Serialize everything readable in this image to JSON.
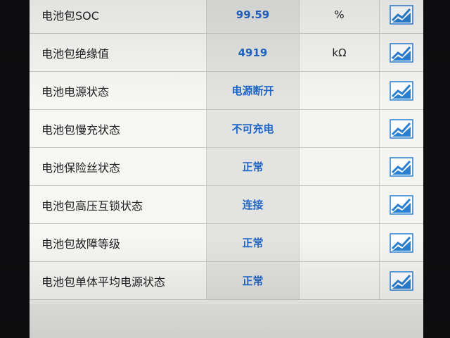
{
  "rows": [
    {
      "label": "电池包SOC",
      "value": "99.59",
      "unit": "%",
      "icon": "trend-chart-icon"
    },
    {
      "label": "电池包绝缘值",
      "value": "4919",
      "unit": "kΩ",
      "icon": "trend-chart-icon"
    },
    {
      "label": "电池电源状态",
      "value": "电源断开",
      "unit": "",
      "icon": "trend-chart-icon"
    },
    {
      "label": "电池包慢充状态",
      "value": "不可充电",
      "unit": "",
      "icon": "trend-chart-icon"
    },
    {
      "label": "电池保险丝状态",
      "value": "正常",
      "unit": "",
      "icon": "trend-chart-icon"
    },
    {
      "label": "电池包高压互锁状态",
      "value": "连接",
      "unit": "",
      "icon": "trend-chart-icon"
    },
    {
      "label": "电池包故障等级",
      "value": "正常",
      "unit": "",
      "icon": "trend-chart-icon"
    },
    {
      "label": "电池包单体平均电源状态",
      "value": "正常",
      "unit": "",
      "icon": "trend-chart-icon"
    }
  ],
  "colors": {
    "value_text": "#2166c4",
    "icon_blue": "#2a7fd0",
    "background": "#f2f3f1"
  }
}
